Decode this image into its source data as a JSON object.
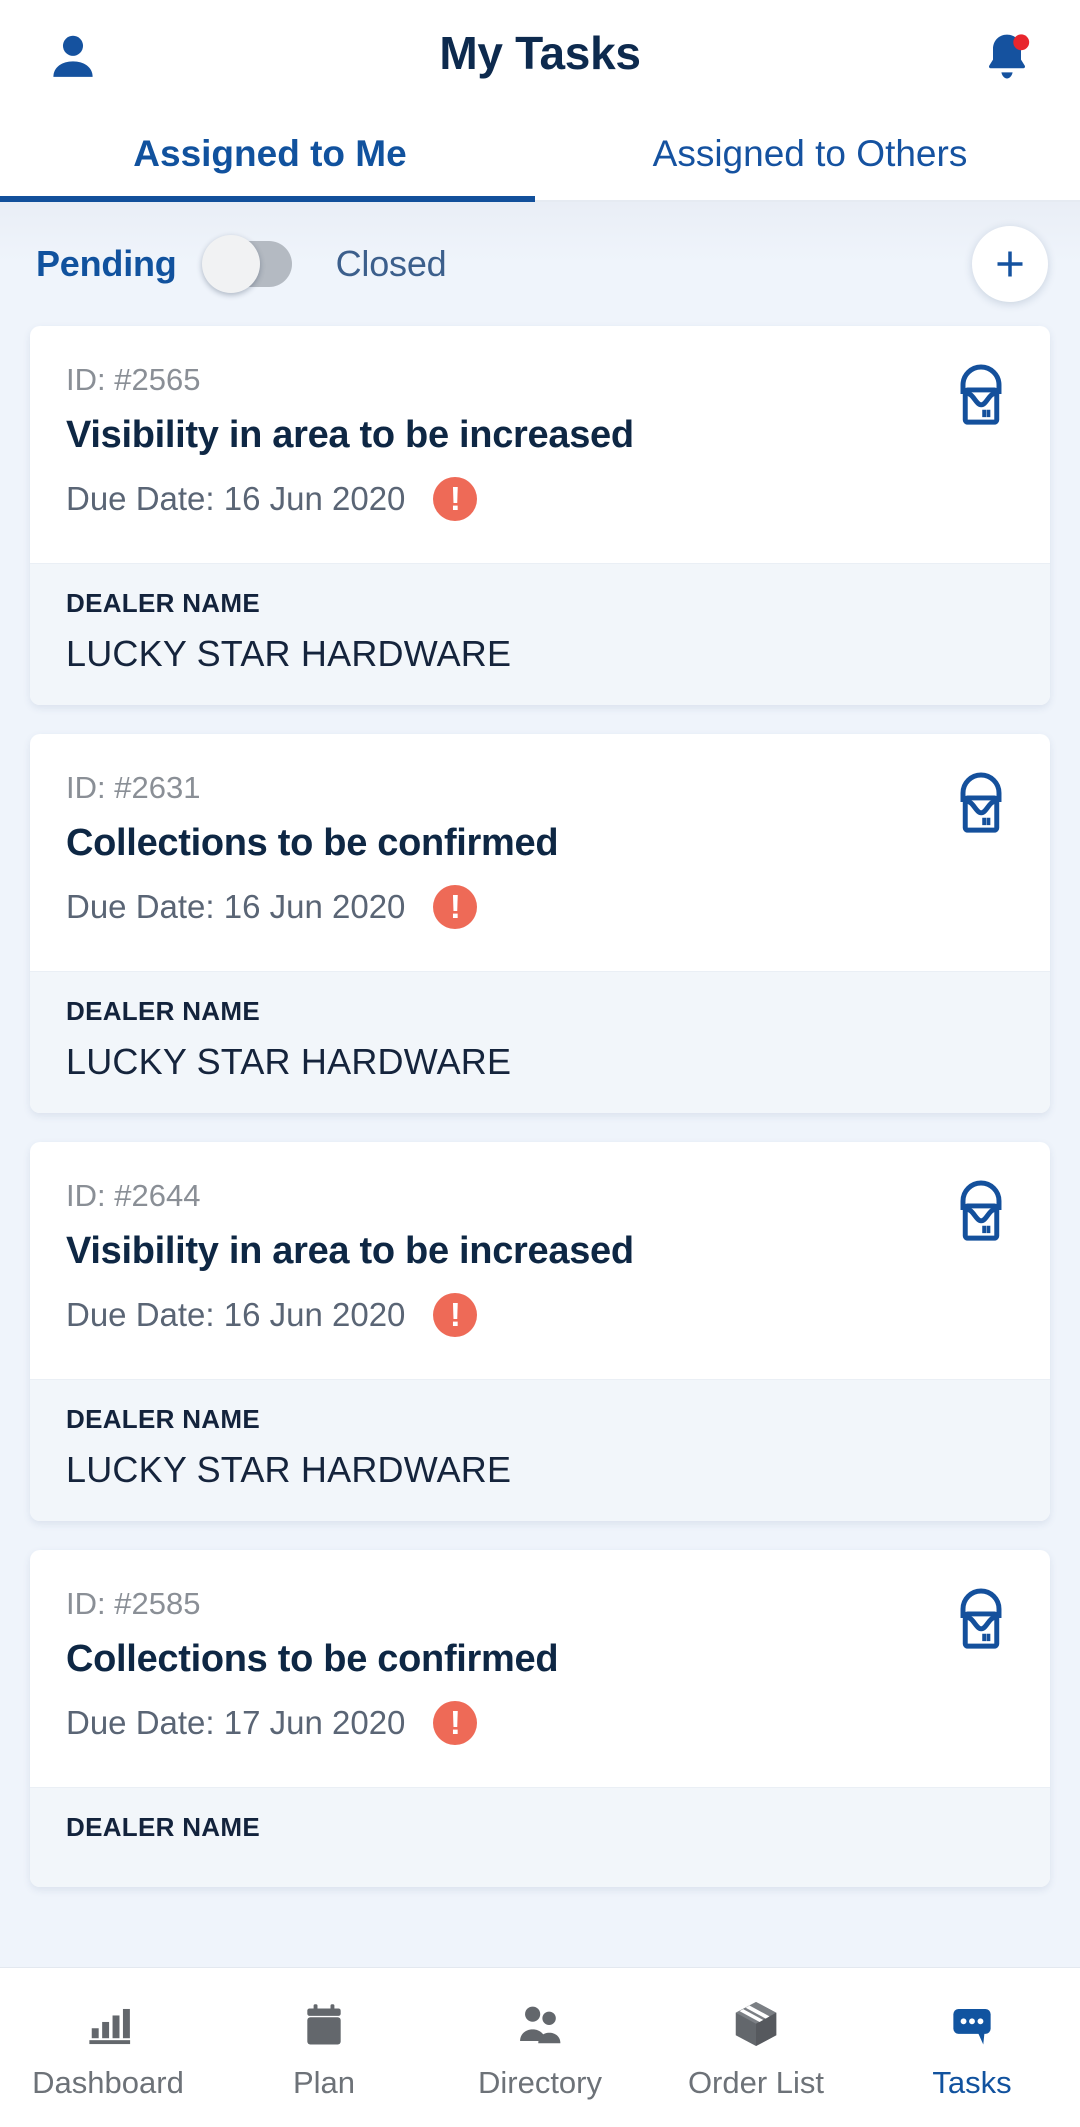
{
  "header": {
    "title": "My Tasks",
    "profile_icon": "person-icon",
    "notification_icon": "bell-icon",
    "notification_dot": true
  },
  "tabs": [
    {
      "label": "Assigned to Me",
      "active": true
    },
    {
      "label": "Assigned to Others",
      "active": false
    }
  ],
  "filter": {
    "pending_label": "Pending",
    "closed_label": "Closed",
    "toggle_state": "pending",
    "add_label": "+"
  },
  "cards": [
    {
      "id_label": "ID: #2565",
      "title": "Visibility in area to be increased",
      "due": "Due Date: 16 Jun 2020",
      "alert": "!",
      "icon": "paint-bucket-icon",
      "footer_label": "DEALER NAME",
      "footer_value": "LUCKY STAR HARDWARE"
    },
    {
      "id_label": "ID: #2631",
      "title": "Collections to be confirmed",
      "due": "Due Date: 16 Jun 2020",
      "alert": "!",
      "icon": "paint-bucket-icon",
      "footer_label": "DEALER NAME",
      "footer_value": "LUCKY STAR HARDWARE"
    },
    {
      "id_label": "ID: #2644",
      "title": "Visibility in area to be increased",
      "due": "Due Date: 16 Jun 2020",
      "alert": "!",
      "icon": "paint-bucket-icon",
      "footer_label": "DEALER NAME",
      "footer_value": "LUCKY STAR HARDWARE"
    },
    {
      "id_label": "ID: #2585",
      "title": "Collections to be confirmed",
      "due": "Due Date: 17 Jun 2020",
      "alert": "!",
      "icon": "paint-bucket-icon",
      "footer_label": "DEALER NAME",
      "footer_value": ""
    }
  ],
  "bottom_nav": [
    {
      "label": "Dashboard",
      "icon": "bar-chart-icon",
      "active": false
    },
    {
      "label": "Plan",
      "icon": "calendar-icon",
      "active": false
    },
    {
      "label": "Directory",
      "icon": "people-icon",
      "active": false
    },
    {
      "label": "Order List",
      "icon": "box-icon",
      "active": false
    },
    {
      "label": "Tasks",
      "icon": "chat-bubble-icon",
      "active": true
    }
  ],
  "colors": {
    "primary_blue": "#11529e",
    "dark_navy": "#0e2744",
    "alert_red": "#ee6a57",
    "notification_red": "#e8262d",
    "page_bg": "#eff4fb",
    "card_footer_bg": "#f2f6fa",
    "nav_inactive": "#6d7278"
  }
}
